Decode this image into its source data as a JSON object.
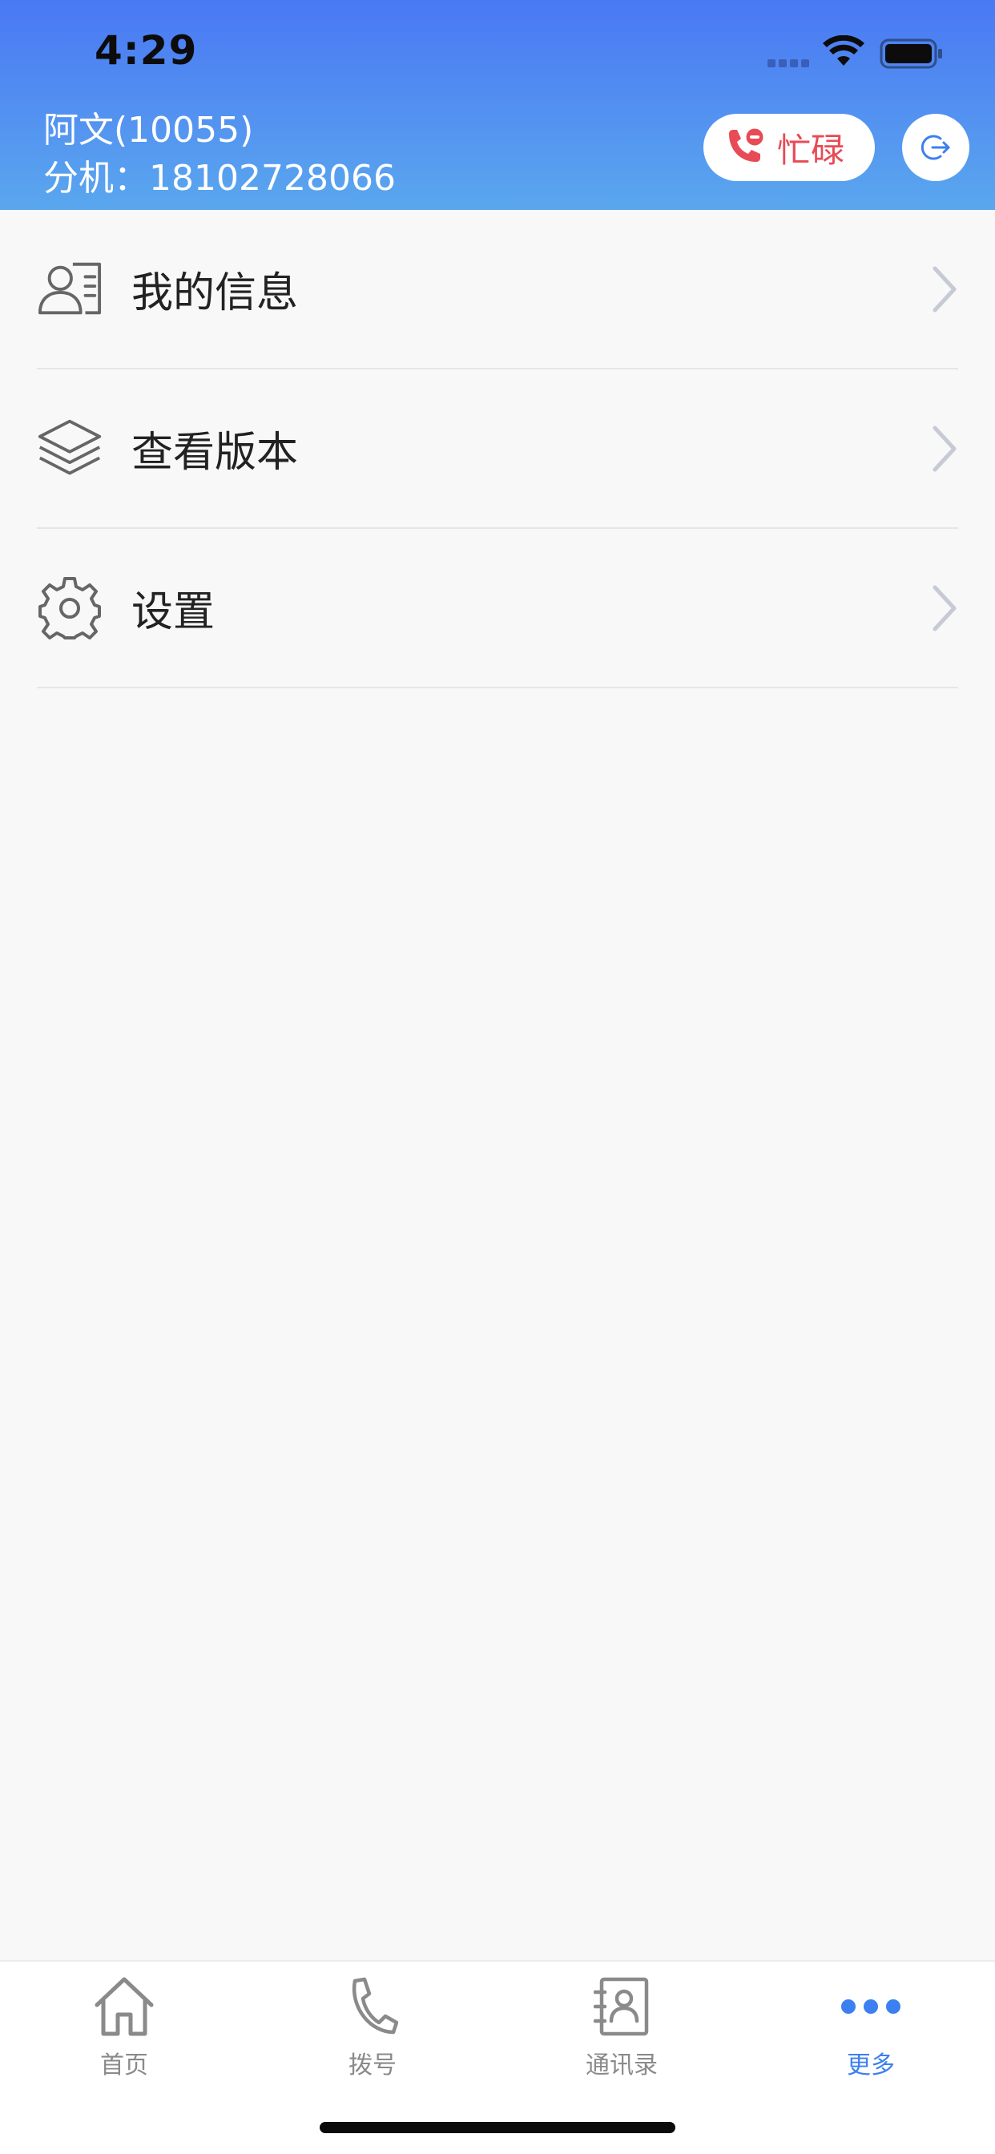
{
  "status_bar": {
    "time": "4:29"
  },
  "header": {
    "user_name": "阿文(10055)",
    "extension": "分机：18102728066",
    "status_label": "忙碌",
    "status_color": "#e84b55"
  },
  "menu": {
    "items": [
      {
        "label": "我的信息",
        "icon": "contact-card-icon"
      },
      {
        "label": "查看版本",
        "icon": "layers-icon"
      },
      {
        "label": "设置",
        "icon": "gear-icon"
      }
    ]
  },
  "tab_bar": {
    "tabs": [
      {
        "label": "首页",
        "icon": "home-icon",
        "active": false
      },
      {
        "label": "拨号",
        "icon": "phone-icon",
        "active": false
      },
      {
        "label": "通讯录",
        "icon": "address-book-icon",
        "active": false
      },
      {
        "label": "更多",
        "icon": "more-dots-icon",
        "active": true
      }
    ],
    "active_color": "#3b7ff0",
    "inactive_color": "#8a8a8a"
  },
  "colors": {
    "header_gradient_top": "#4a78f4",
    "header_gradient_bottom": "#5aa7ee",
    "background": "#f8f8f8"
  }
}
